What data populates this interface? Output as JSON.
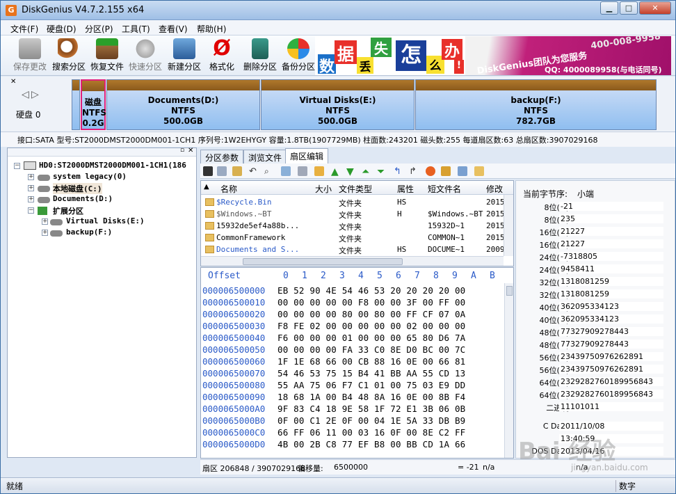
{
  "window": {
    "title": "DiskGenius V4.7.2.155 x64",
    "icon_letter": "G"
  },
  "menu": [
    "文件(F)",
    "硬盘(D)",
    "分区(P)",
    "工具(T)",
    "查看(V)",
    "帮助(H)"
  ],
  "toolbar": [
    {
      "label": "保存更改",
      "icon": "save-icon",
      "disabled": true
    },
    {
      "label": "搜索分区",
      "icon": "search-partition-icon"
    },
    {
      "label": "恢复文件",
      "icon": "recover-files-icon"
    },
    {
      "label": "快速分区",
      "icon": "quick-partition-icon",
      "disabled": true
    },
    {
      "label": "新建分区",
      "icon": "new-partition-icon"
    },
    {
      "label": "格式化",
      "icon": "format-icon"
    },
    {
      "label": "删除分区",
      "icon": "delete-partition-icon"
    },
    {
      "label": "备份分区",
      "icon": "backup-partition-icon"
    }
  ],
  "banner": {
    "chars": [
      "数",
      "据",
      "丢",
      "失",
      "怎",
      "么",
      "办",
      "!"
    ],
    "brand": "DiskGenius团队为您服务",
    "phone": "400-008-9958",
    "qq": "QQ: 4000089958(与电话同号)"
  },
  "disk_nav": {
    "label": "硬盘 0"
  },
  "partitions": [
    {
      "name": "磁盘",
      "fs": "NTFS",
      "size": "0.2G",
      "selected": true
    },
    {
      "name": "Documents(D:)",
      "fs": "NTFS",
      "size": "500.0GB"
    },
    {
      "name": "Virtual Disks(E:)",
      "fs": "NTFS",
      "size": "500.0GB"
    },
    {
      "name": "backup(F:)",
      "fs": "NTFS",
      "size": "782.7GB"
    }
  ],
  "disk_info": "接口:SATA  型号:ST2000DMST2000DM001-1CH1  序列号:1W2EHYGY  容量:1.8TB(1907729MB)  柱面数:243201  磁头数:255  每道扇区数:63  总扇区数:3907029168",
  "tree": {
    "root": "HD0:ST2000DMST2000DM001-1CH1(186",
    "items": [
      {
        "label": "system legacy(0)",
        "color": "#8a5a00",
        "level": 1
      },
      {
        "label": "本地磁盘(C:)",
        "color": "#b05000",
        "level": 1
      },
      {
        "label": "Documents(D:)",
        "color": "#8a5a00",
        "level": 1
      },
      {
        "label": "扩展分区",
        "color": "#1a7a1a",
        "level": 1
      },
      {
        "label": "Virtual Disks(E:)",
        "color": "#8a5a00",
        "level": 2
      },
      {
        "label": "backup(F:)",
        "color": "#8a5a00",
        "level": 2
      }
    ]
  },
  "tabs": [
    "分区参数",
    "浏览文件",
    "扇区编辑"
  ],
  "active_tab": 2,
  "file_list": {
    "headers": [
      "名称",
      "大小",
      "文件类型",
      "属性",
      "短文件名",
      "修改"
    ],
    "rows": [
      {
        "name": "$Recycle.Bin",
        "size": "",
        "type": "文件夹",
        "attr": "HS",
        "short": "",
        "mod": "2015",
        "color": "#2a5ac8"
      },
      {
        "name": "$Windows.~BT",
        "size": "",
        "type": "文件夹",
        "attr": "H",
        "short": "$Windows.~BT",
        "mod": "2015",
        "color": "#555"
      },
      {
        "name": "15932de5ef4a88b...",
        "size": "",
        "type": "文件夹",
        "attr": "",
        "short": "15932D~1",
        "mod": "2015",
        "color": "#000"
      },
      {
        "name": "CommonFramework",
        "size": "",
        "type": "文件夹",
        "attr": "",
        "short": "COMMON~1",
        "mod": "2015",
        "color": "#000"
      },
      {
        "name": "Documents and S...",
        "size": "",
        "type": "文件夹",
        "attr": "HS",
        "short": "DOCUME~1",
        "mod": "2009",
        "color": "#2a5ac8"
      }
    ]
  },
  "hex": {
    "header_offset": "Offset",
    "header_cols": [
      "0",
      "1",
      "2",
      "3",
      "4",
      "5",
      "6",
      "7",
      "8",
      "9",
      "A",
      "B"
    ],
    "rows": [
      {
        "off": "000006500000",
        "bytes": "EB 52 90 4E 54 46 53 20 20 20 20 00"
      },
      {
        "off": "000006500010",
        "bytes": "00 00 00 00 00 F8 00 00 3F 00 FF 00"
      },
      {
        "off": "000006500020",
        "bytes": "00 00 00 00 80 00 80 00 FF CF 07 0A"
      },
      {
        "off": "000006500030",
        "bytes": "F8 FE 02 00 00 00 00 00 02 00 00 00"
      },
      {
        "off": "000006500040",
        "bytes": "F6 00 00 00 01 00 00 00 65 80 D6 7A"
      },
      {
        "off": "000006500050",
        "bytes": "00 00 00 00 FA 33 C0 8E D0 BC 00 7C"
      },
      {
        "off": "000006500060",
        "bytes": "1F 1E 68 66 00 CB 88 16 0E 00 66 81"
      },
      {
        "off": "000006500070",
        "bytes": "54 46 53 75 15 B4 41 BB AA 55 CD 13"
      },
      {
        "off": "000006500080",
        "bytes": "55 AA 75 06 F7 C1 01 00 75 03 E9 DD"
      },
      {
        "off": "000006500090",
        "bytes": "18 68 1A 00 B4 48 8A 16 0E 00 8B F4"
      },
      {
        "off": "0000065000A0",
        "bytes": "9F 83 C4 18 9E 58 1F 72 E1 3B 06 0B"
      },
      {
        "off": "0000065000B0",
        "bytes": "0F 00 C1 2E 0F 00 04 1E 5A 33 DB B9"
      },
      {
        "off": "0000065000C0",
        "bytes": "66 FF 06 11 00 03 16 0F 00 8E C2 FF"
      },
      {
        "off": "0000065000D0",
        "bytes": "4B 00 2B C8 77 EF B8 00 BB CD 1A 66"
      }
    ]
  },
  "interpret": {
    "byte_order_label": "当前字节序:",
    "byte_order": "小端",
    "rows": [
      {
        "label": "8位(±):",
        "value": "-21"
      },
      {
        "label": "8位(+):",
        "value": "235"
      },
      {
        "label": "16位(±):",
        "value": "21227"
      },
      {
        "label": "16位(+):",
        "value": "21227"
      },
      {
        "label": "24位(±):",
        "value": "-7318805"
      },
      {
        "label": "24位(+):",
        "value": "9458411"
      },
      {
        "label": "32位(±):",
        "value": "1318081259"
      },
      {
        "label": "32位(+):",
        "value": "1318081259"
      },
      {
        "label": "40位(±):",
        "value": "362095334123"
      },
      {
        "label": "40位(+):",
        "value": "362095334123"
      },
      {
        "label": "48位(±):",
        "value": "77327909278443"
      },
      {
        "label": "48位(+):",
        "value": "77327909278443"
      },
      {
        "label": "56位(±):",
        "value": "23439750976262891"
      },
      {
        "label": "56位(+):",
        "value": "23439750976262891"
      },
      {
        "label": "64位(±):",
        "value": "2329282760189956843"
      },
      {
        "label": "64位(+):",
        "value": "2329282760189956843"
      },
      {
        "label": "二进制:",
        "value": "11101011"
      }
    ],
    "dates": [
      {
        "label": "C Date:",
        "value": "2011/10/08"
      },
      {
        "label": "",
        "value": "13:40:59"
      },
      {
        "label": "DOS Date:",
        "value": "2013/04/16"
      }
    ]
  },
  "sector_status": {
    "sector": "扇区 206848 / 3907029168",
    "offset_label": "偏移量:",
    "offset": "6500000",
    "value": "= -21",
    "na1": "n/a",
    "na2": "n/a"
  },
  "status": {
    "left": "就绪",
    "right": "数字"
  },
  "watermark": {
    "main": "Bai 经验",
    "sub": "jingyan.baidu.com"
  }
}
